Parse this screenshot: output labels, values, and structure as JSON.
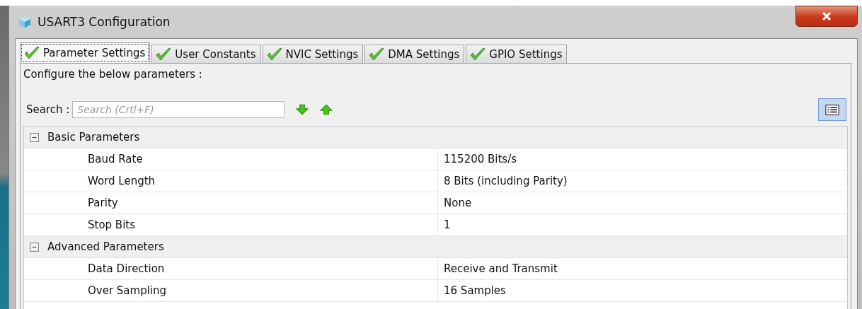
{
  "window": {
    "title": "USART3 Configuration"
  },
  "tabs": [
    {
      "label": "Parameter Settings",
      "selected": true,
      "valid": true
    },
    {
      "label": "User Constants",
      "selected": false,
      "valid": true
    },
    {
      "label": "NVIC Settings",
      "selected": false,
      "valid": true
    },
    {
      "label": "DMA Settings",
      "selected": false,
      "valid": true
    },
    {
      "label": "GPIO Settings",
      "selected": false,
      "valid": true
    }
  ],
  "intro": "Configure the below parameters :",
  "search": {
    "label": "Search :",
    "placeholder": "Search (Crtl+F)"
  },
  "groups": [
    {
      "name": "Basic Parameters",
      "expanded": true,
      "rows": [
        {
          "name": "Baud Rate",
          "value": "115200 Bits/s"
        },
        {
          "name": "Word Length",
          "value": "8 Bits (including Parity)"
        },
        {
          "name": "Parity",
          "value": "None"
        },
        {
          "name": "Stop Bits",
          "value": "1"
        }
      ]
    },
    {
      "name": "Advanced Parameters",
      "expanded": true,
      "rows": [
        {
          "name": "Data Direction",
          "value": "Receive and Transmit"
        },
        {
          "name": "Over Sampling",
          "value": "16 Samples"
        }
      ]
    }
  ]
}
